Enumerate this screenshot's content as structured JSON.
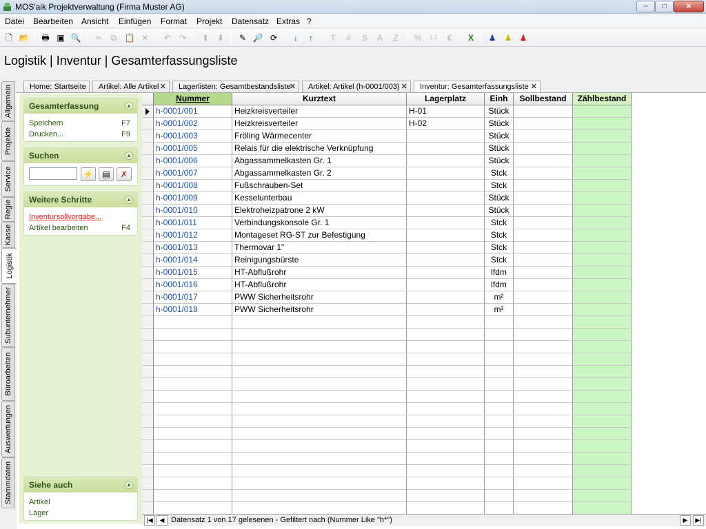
{
  "window": {
    "title": "MOS'aik Projektverwaltung (Firma Muster AG)",
    "min": "─",
    "max": "□",
    "close": "✕"
  },
  "menu": [
    "Datei",
    "Bearbeiten",
    "Ansicht",
    "Einfügen",
    "Format",
    "Projekt",
    "Datensatz",
    "Extras",
    "?"
  ],
  "page_title": "Logistik | Inventur | Gesamterfassungsliste",
  "vertical_tabs": [
    "Allgemein",
    "Projekte",
    "Service",
    "Regie",
    "Kasse",
    "Logistik",
    "Subunternehmer",
    "Büroarbeiten",
    "Auswertungen",
    "Stammdaten"
  ],
  "active_vertical_tab": "Logistik",
  "tabs": [
    {
      "label": "Home: Startseite",
      "closable": false
    },
    {
      "label": "Artikel: Alle Artikel",
      "closable": true
    },
    {
      "label": "Lagerlisten: Gesamtbestandsliste",
      "closable": true
    },
    {
      "label": "Artikel: Artikel (h-0001/003)",
      "closable": true
    },
    {
      "label": "Inventur: Gesamterfassungsliste",
      "closable": true,
      "active": true
    }
  ],
  "panels": {
    "gesamt": {
      "title": "Gesamterfassung",
      "items": [
        {
          "label": "Speichern",
          "key": "F7"
        },
        {
          "label": "Drucken...",
          "key": "F9"
        }
      ]
    },
    "suchen": {
      "title": "Suchen",
      "value": ""
    },
    "weitere": {
      "title": "Weitere Schritte",
      "items": [
        {
          "label": "Inventursollvorgabe...",
          "key": ""
        },
        {
          "label": "Artikel bearbeiten",
          "key": "F4"
        }
      ]
    },
    "siehe": {
      "title": "Siehe auch",
      "items": [
        {
          "label": "Artikel"
        },
        {
          "label": "Läger"
        }
      ]
    }
  },
  "columns": [
    "Nummer",
    "Kurztext",
    "Lagerplatz",
    "Einh",
    "Sollbestand",
    "Zählbestand"
  ],
  "rows": [
    [
      "h-0001/001",
      "Heizkreisverteiler",
      "H-01",
      "Stück",
      "",
      ""
    ],
    [
      "h-0001/002",
      "Heizkreisverteiler",
      "H-02",
      "Stück",
      "",
      ""
    ],
    [
      "h-0001/003",
      "Fröling Wärmecenter",
      "",
      "Stück",
      "",
      ""
    ],
    [
      "h-0001/005",
      "Relais für die elektrische Verknüpfung",
      "",
      "Stück",
      "",
      ""
    ],
    [
      "h-0001/006",
      "Abgassammelkasten Gr. 1",
      "",
      "Stück",
      "",
      ""
    ],
    [
      "h-0001/007",
      "Abgassammelkasten Gr. 2",
      "",
      "Stck",
      "",
      ""
    ],
    [
      "h-0001/008",
      "Fußschrauben-Set",
      "",
      "Stck",
      "",
      ""
    ],
    [
      "h-0001/009",
      "Kesselunterbau",
      "",
      "Stück",
      "",
      ""
    ],
    [
      "h-0001/010",
      "Elektroheizpatrone 2 kW",
      "",
      "Stück",
      "",
      ""
    ],
    [
      "h-0001/011",
      "Verbindungskonsole Gr. 1",
      "",
      "Stck",
      "",
      ""
    ],
    [
      "h-0001/012",
      "Montageset RG-ST zur Befestigung",
      "",
      "Stck",
      "",
      ""
    ],
    [
      "h-0001/013",
      "Thermovar 1\"",
      "",
      "Stck",
      "",
      ""
    ],
    [
      "h-0001/014",
      "Reinigungsbürste",
      "",
      "Stck",
      "",
      ""
    ],
    [
      "h-0001/015",
      "HT-Abflußrohr",
      "",
      "lfdm",
      "",
      ""
    ],
    [
      "h-0001/016",
      "HT-Abflußrohr",
      "",
      "lfdm",
      "",
      ""
    ],
    [
      "h-0001/017",
      "PWW Sicherheitsrohr",
      "",
      "m²",
      "",
      ""
    ],
    [
      "h-0001/018",
      "PWW Sicherheitsrohr",
      "",
      "m²",
      "",
      ""
    ]
  ],
  "status": "Datensatz 1 von 17 gelesenen - Gefiltert nach (Nummer Like \"h*\")"
}
